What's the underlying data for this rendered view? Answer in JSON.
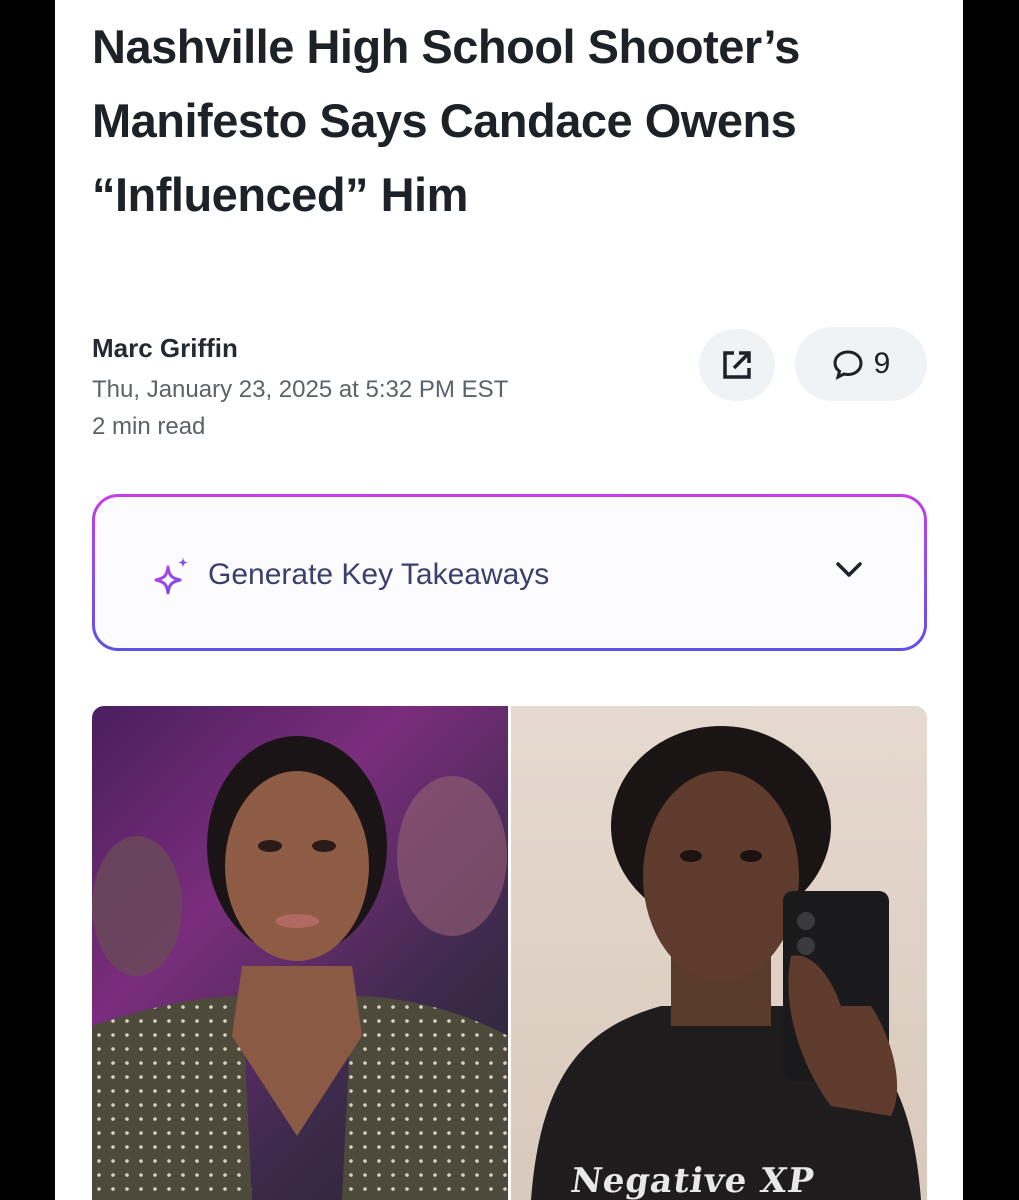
{
  "article": {
    "title": "Nashville High School Shooter’s Manifesto Says Candace Owens “Influenced” Him",
    "author": "Marc Griffin",
    "date": "Thu, January 23, 2025 at 5:32 PM EST",
    "read_time": "2 min read"
  },
  "actions": {
    "share_icon": "share-external-icon",
    "comment_icon": "speech-bubble-icon",
    "comment_count": "9"
  },
  "takeaways": {
    "label": "Generate Key Takeaways",
    "icon": "sparkle-icon",
    "chevron": "chevron-down-icon"
  },
  "hero": {
    "right_shirt_text": "Negative  XP"
  },
  "colors": {
    "title": "#1d2228",
    "secondary_text": "#5b636a",
    "button_bg": "#f0f3f5",
    "gradient_top": "#c63de6",
    "gradient_bottom": "#5b52e8",
    "takeaway_text": "#3b3f6e"
  }
}
